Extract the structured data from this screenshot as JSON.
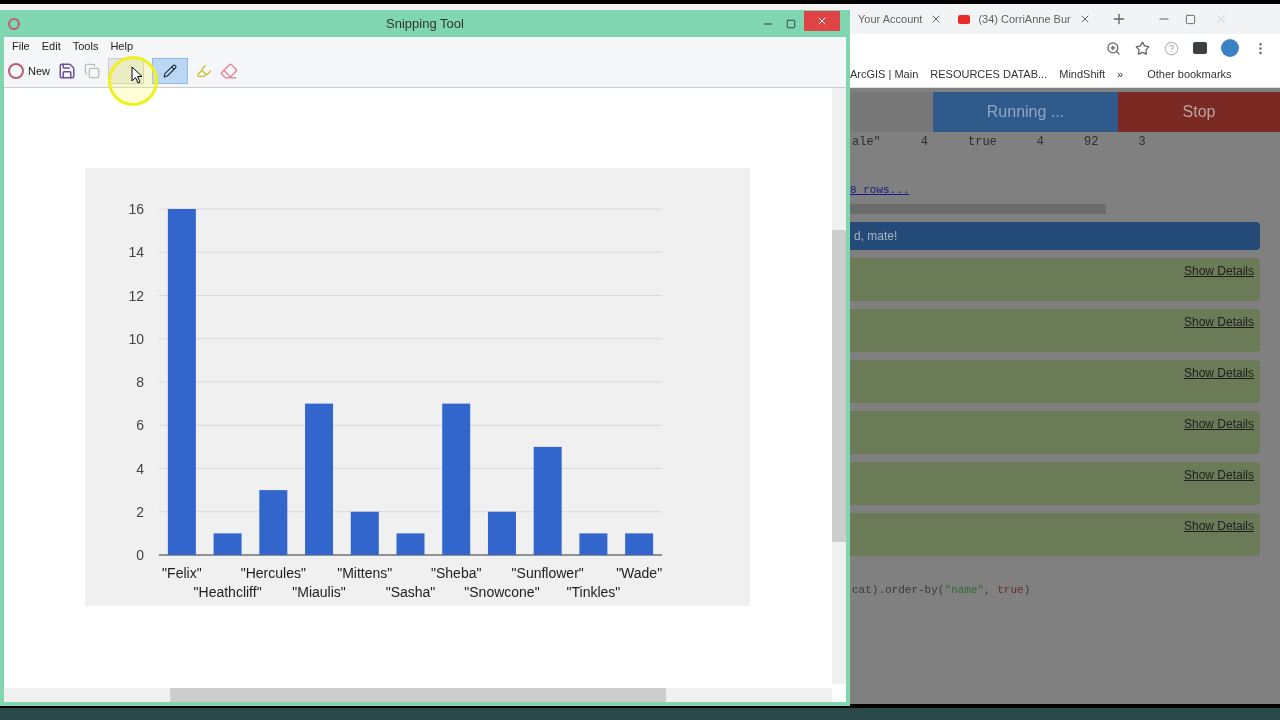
{
  "snipping_tool": {
    "title": "Snipping Tool",
    "menu": [
      "File",
      "Edit",
      "Tools",
      "Help"
    ],
    "new_label": "New",
    "chart_data": {
      "type": "bar",
      "categories": [
        "\"Felix\"",
        "\"Heathcliff\"",
        "\"Hercules\"",
        "\"Miaulis\"",
        "\"Mittens\"",
        "\"Sasha\"",
        "\"Sheba\"",
        "\"Snowcone\"",
        "\"Sunflower\"",
        "\"Tinkles\"",
        "\"Wade\""
      ],
      "grid": true,
      "series": [
        {
          "color": "#3366cc",
          "values": [
            16,
            1,
            3,
            7,
            2,
            1,
            7,
            2,
            5,
            1,
            1
          ]
        }
      ],
      "ylim": [
        0,
        16
      ],
      "yticks": [
        0,
        2,
        4,
        6,
        8,
        10,
        12,
        14,
        16
      ]
    }
  },
  "browser": {
    "tabs": [
      {
        "label": "Your Account",
        "selected": false
      },
      {
        "label": "(34) CorriAnne Bur",
        "selected": false
      }
    ],
    "bookmarks": [
      "ArcGIS | Main",
      "RESOURCES DATAB...",
      "MindShift",
      "»",
      "Other bookmarks"
    ],
    "page": {
      "run_button": "Running ...",
      "stop_button": "Stop",
      "row": [
        "ale\"",
        "4",
        "true",
        "4",
        "92",
        "3"
      ],
      "more_rows": "8 rows...",
      "banner": "d, mate!",
      "cards": [
        "Show Details",
        "Show Details",
        "Show Details",
        "Show Details",
        "Show Details",
        "Show Details"
      ],
      "code": [
        {
          "text": "cat).order-by(",
          "kind": "plain"
        },
        {
          "text": "\"name\"",
          "kind": "string"
        },
        {
          "text": ", ",
          "kind": "plain"
        },
        {
          "text": "true",
          "kind": "keyword"
        },
        {
          "text": ")",
          "kind": "plain"
        }
      ]
    }
  }
}
